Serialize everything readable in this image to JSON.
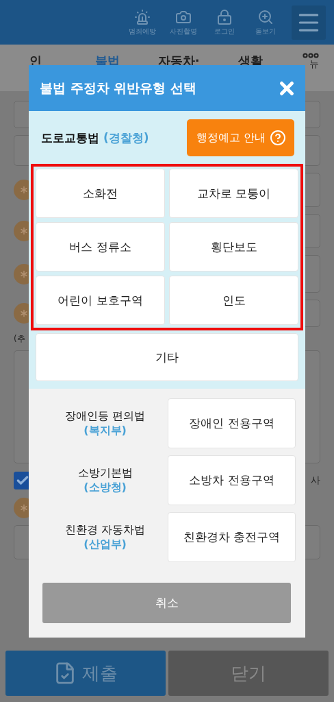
{
  "header": {
    "icons": [
      {
        "kind": "siren",
        "label": "범죄예방"
      },
      {
        "kind": "camera",
        "label": "사진촬영"
      },
      {
        "kind": "lock",
        "label": "로그인"
      },
      {
        "kind": "zoom",
        "label": "돋보기"
      }
    ]
  },
  "tabs": [
    {
      "label": "인",
      "selected": false
    },
    {
      "label": "불법",
      "selected": true
    },
    {
      "label": "자동차·",
      "selected": false
    },
    {
      "label": "생활",
      "selected": false
    }
  ],
  "more_menu": {
    "label": "뉴"
  },
  "form": {
    "note": "(추",
    "side_text": "사",
    "agree_checked": true
  },
  "modal": {
    "title": "불법 주정차 위반유형 선택",
    "road_law": {
      "name": "도로교통법",
      "agency": "(경찰청)"
    },
    "info_button": "행정예고 안내",
    "highlighted": true,
    "options": [
      "소화전",
      "교차로 모퉁이",
      "버스 정류소",
      "횡단보도",
      "어린이 보호구역",
      "인도"
    ],
    "other_option": "기타",
    "other_laws": [
      {
        "name": "장애인등 편의법",
        "agency": "(복지부)",
        "option": "장애인 전용구역"
      },
      {
        "name": "소방기본법",
        "agency": "(소방청)",
        "option": "소방차 전용구역"
      },
      {
        "name": "친환경 자동차법",
        "agency": "(산업부)",
        "option": "친환경차 충전구역"
      }
    ],
    "cancel": "취소"
  },
  "footer_buttons": [
    {
      "kind": "submit",
      "label": "제출"
    },
    {
      "kind": "close",
      "label": "닫기"
    }
  ]
}
